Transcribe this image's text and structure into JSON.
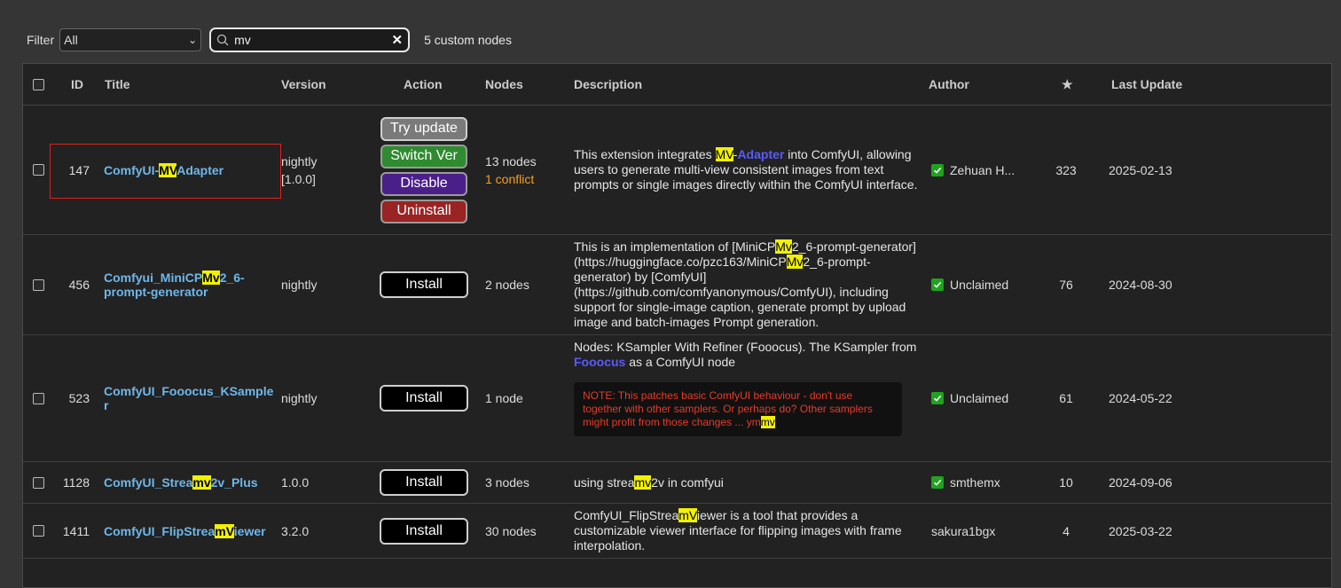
{
  "toolbar": {
    "filter_label": "Filter",
    "filter_value": "All",
    "search_value": "mv",
    "result_count": "5 custom nodes"
  },
  "columns": {
    "id": "ID",
    "title": "Title",
    "version": "Version",
    "action": "Action",
    "nodes": "Nodes",
    "description": "Description",
    "author": "Author",
    "stars": "★",
    "last_update": "Last Update"
  },
  "buttons": {
    "try_update": "Try update",
    "switch_ver": "Switch Ver",
    "disable": "Disable",
    "uninstall": "Uninstall",
    "install": "Install"
  },
  "rows": [
    {
      "id": "147",
      "title_pre": "ComfyUI-",
      "title_hl": "MV",
      "title_post": "Adapter",
      "version": "nightly",
      "version2": "[1.0.0]",
      "nodes": "13 nodes",
      "conflict": "1 conflict",
      "desc_a": "This extension integrates ",
      "desc_hl": "MV",
      "desc_b": "-",
      "desc_link": "Adapter",
      "desc_c": " into ComfyUI, allowing users to generate multi-view consistent images from text prompts or single images directly within the ComfyUI interface.",
      "author": "Zehuan H...",
      "stars": "323",
      "date": "2025-02-13"
    },
    {
      "id": "456",
      "title_pre": "Comfyui_MiniCP",
      "title_hl": "Mv",
      "title_post": "2_6-prompt-generator",
      "version": "nightly",
      "nodes": "2 nodes",
      "desc_a": "This is an implementation of [MiniCP",
      "desc_hl": "Mv",
      "desc_b": "2_6-prompt-generator](https://huggingface.co/pzc163/MiniCP",
      "desc_hl2": "Mv",
      "desc_c": "2_6-prompt-generator) by [ComfyUI](https://github.com/comfyanonymous/ComfyUI), including support for single-image caption, generate prompt by upload image and batch-images Prompt generation.",
      "author": "Unclaimed",
      "stars": "76",
      "date": "2024-08-30"
    },
    {
      "id": "523",
      "title": "ComfyUI_Fooocus_KSampler",
      "version": "nightly",
      "nodes": "1 node",
      "desc_a": "Nodes: KSampler With Refiner (Fooocus). The KSampler from ",
      "desc_link": "Fooocus",
      "desc_c": " as a ComfyUI node",
      "note": "NOTE: This patches basic ComfyUI behaviour - don't use together with other samplers. Or perhaps do? Other samplers might profit from those changes ... ym",
      "note_hl": "mv",
      "author": "Unclaimed",
      "stars": "61",
      "date": "2024-05-22"
    },
    {
      "id": "1128",
      "title_pre": "ComfyUI_Strea",
      "title_hl": "mv",
      "title_post": "2v_Plus",
      "version": "1.0.0",
      "nodes": "3 nodes",
      "desc_a": "using strea",
      "desc_hl": "mv",
      "desc_c": "2v in comfyui",
      "author": "smthemx",
      "stars": "10",
      "date": "2024-09-06"
    },
    {
      "id": "1411",
      "title_pre": "ComfyUI_FlipStrea",
      "title_hl": "mV",
      "title_post": "iewer",
      "version": "3.2.0",
      "nodes": "30 nodes",
      "desc_a": "ComfyUI_FlipStrea",
      "desc_hl": "mV",
      "desc_c": "iewer is a tool that provides a customizable viewer interface for flipping images with frame interpolation.",
      "author": "sakura1bgx",
      "stars": "4",
      "date": "2025-03-22"
    }
  ]
}
